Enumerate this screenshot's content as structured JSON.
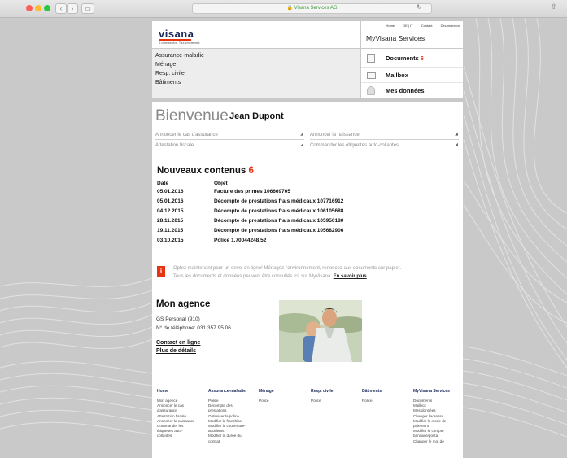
{
  "browser": {
    "url": "Visana Services AG"
  },
  "header": {
    "logo": "visana",
    "tagline": "A votre service. Tout simplement.",
    "top_links": [
      "Home",
      "DE | IT",
      "Contact",
      "Déconnexion"
    ],
    "portal_title": "MyVisana Services"
  },
  "insurance_menu": [
    "Assurance-maladie",
    "Ménage",
    "Resp. civile",
    "Bâtiments"
  ],
  "services": [
    {
      "label": "Documents",
      "count": "6",
      "icon": "document-icon"
    },
    {
      "label": "Mailbox",
      "count": "",
      "icon": "mail-icon"
    },
    {
      "label": "Mes données",
      "count": "",
      "icon": "user-icon"
    }
  ],
  "welcome": {
    "greeting": "Bienvenue",
    "name": "Jean Dupont"
  },
  "actions": [
    "Annoncer le cas d'assurance",
    "Annoncer la naissance",
    "Attestation fiscale",
    "Commander les étiquettes auto-collantes"
  ],
  "new_content": {
    "title": "Nouveaux contenus",
    "count": "6",
    "col_date": "Date",
    "col_object": "Objet",
    "rows": [
      {
        "date": "05.01.2016",
        "object": "Facture des primes 106669705"
      },
      {
        "date": "05.01.2016",
        "object": "Décompte de prestations frais médicaux 107716912"
      },
      {
        "date": "04.12.2015",
        "object": "Décompte de prestations frais médicaux 106105688"
      },
      {
        "date": "28.11.2015",
        "object": "Décompte de prestations frais médicaux 105950180"
      },
      {
        "date": "19.11.2015",
        "object": "Décompte de prestations frais médicaux 105682906"
      },
      {
        "date": "03.10.2015",
        "object": "Police 1.70044248.52"
      }
    ]
  },
  "notice": {
    "text_1": "Optez maintenant pour un envoi en ligne! Ménagez l'environnement, renoncez aux documents sur papier.",
    "text_2": "Tous les documents et données peuvent être consultés ici, sur MyVisana.",
    "link": "En savoir plus"
  },
  "agency": {
    "title": "Mon agence",
    "name": "GS Personal (910)",
    "phone": "N° de téléphone: 031 357 95 06",
    "link_contact": "Contact en ligne",
    "link_details": "Plus de détails"
  },
  "footer": {
    "columns": [
      {
        "head": "Home",
        "items": [
          "Mon agence",
          "Annoncer le cas",
          "d'assurance",
          "Attestation fiscale",
          "Annoncer la naissance",
          "Commander les",
          "étiquettes auto-",
          "collantes"
        ]
      },
      {
        "head": "Assurance-maladie",
        "items": [
          "Police",
          "Décompte des",
          "prestations",
          "Optimiser la police",
          "Modifier la franchise",
          "Modifier la couverture-",
          "accidents",
          "Modifier la durée du",
          "contrat"
        ]
      },
      {
        "head": "Ménage",
        "items": [
          "Police"
        ]
      },
      {
        "head": "Resp. civile",
        "items": [
          "Police"
        ]
      },
      {
        "head": "Bâtiments",
        "items": [
          "Police"
        ]
      },
      {
        "head": "MyVisana Services",
        "items": [
          "Documents",
          "Mailbox",
          "Mes données",
          "Changer l'adresse",
          "Modifier le mode de",
          "paiement",
          "Modifier le compte",
          "bancaire/postal",
          "Changer le mot de"
        ]
      }
    ]
  }
}
